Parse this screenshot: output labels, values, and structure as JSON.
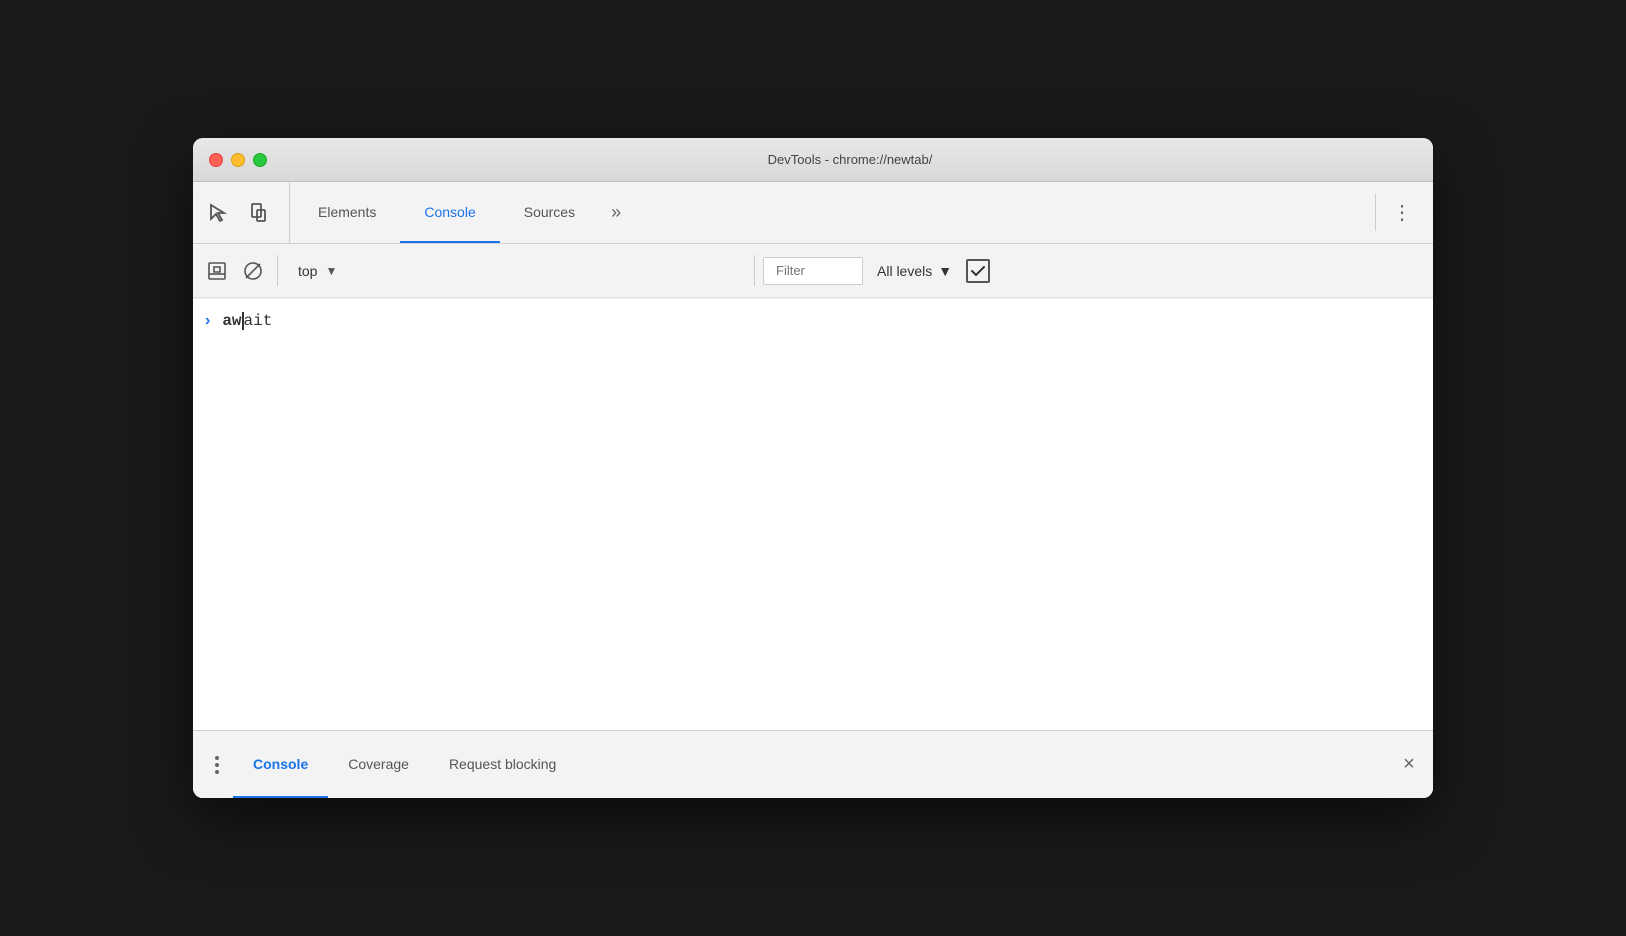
{
  "window": {
    "title": "DevTools - chrome://newtab/"
  },
  "traffic_lights": {
    "close_label": "close",
    "minimize_label": "minimize",
    "maximize_label": "maximize"
  },
  "top_toolbar": {
    "tabs": [
      {
        "id": "elements",
        "label": "Elements",
        "active": false
      },
      {
        "id": "console",
        "label": "Console",
        "active": true
      },
      {
        "id": "sources",
        "label": "Sources",
        "active": false
      }
    ],
    "more_tabs_label": "»",
    "more_options_label": "⋮"
  },
  "console_toolbar": {
    "context": "top",
    "filter_placeholder": "Filter",
    "levels": "All levels",
    "checkbox_checked": true
  },
  "console_output": {
    "prompt_arrow": "›",
    "input_text_bold": "aw",
    "input_text_normal": "ait"
  },
  "bottom_drawer": {
    "tabs": [
      {
        "id": "console",
        "label": "Console",
        "active": true
      },
      {
        "id": "coverage",
        "label": "Coverage",
        "active": false
      },
      {
        "id": "request-blocking",
        "label": "Request blocking",
        "active": false
      }
    ],
    "close_label": "×"
  }
}
